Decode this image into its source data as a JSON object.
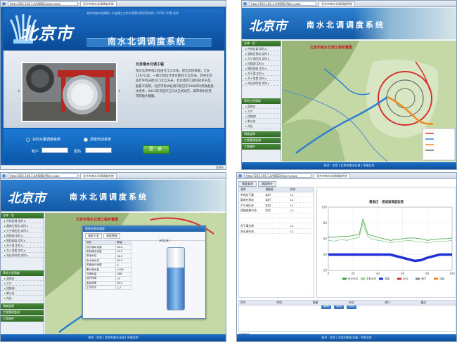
{
  "browser1": {
    "url": "http://202.106.1.0/NSBD/Login.aspx",
    "tab": "北京市南水北调调度系统",
    "zoom": "100%"
  },
  "browser2": {
    "url": "http://202.106.1.0/NSBD/Main.aspx",
    "tab": "北京市南水北调调度系统"
  },
  "browser3": {
    "url": "http://202.106.1.0/NSBD/Main.aspx",
    "tab": "北京市南水北调调度系统"
  },
  "browser4": {
    "url": "http://202.106.1.0/NSBD/Query.aspx",
    "tab": "北京市南水北调调度系统"
  },
  "login": {
    "logo": "北京市",
    "toplinks": "北京市南水北调网 | 大连理工大学水资源与防洪研究所 | 2013 | 中国·北京",
    "system_title": "南水北调调度系统",
    "news_title": "北京南水北调工程",
    "news_body": "南水北调中线工程由丹江口水库，经北京团城湖，全长1267公里，一期工程设计调水量95亿立方米，其中北京多年平均分配10.5亿立方米。北京境内工程包括总干渠、配套工程等。北京市南水北调工程已于2008年9月具备通水条件，2014年汛后丹江口水正式进京，城市供水形势得到极大缓解。",
    "radio1": "实时水量调度系统",
    "radio2": "调度培训系统",
    "user_label": "账户",
    "password_label": "密码",
    "login_button": "登 录"
  },
  "app": {
    "logo": "北京市",
    "title": "南水北调调度系统",
    "sidebar_head": "总体 · 总",
    "side_items": [
      "中线总调 实时 ▸",
      "惠南庄泵站 实时 ▸",
      "大宁调压池 实时 ▸",
      "团城湖 实时 ▸",
      "颐和园段 实时 ▸",
      "东干渠 实时 ▸",
      "东十里堡 实时 ▸",
      "亦庄调节池 实时 ▸"
    ],
    "sidebar_head2": "泵站工程调度",
    "side_items2": [
      "惠南庄",
      "大宁",
      "团城湖",
      "郭公庄",
      "亦庄"
    ],
    "sidebar_head3": "调度监测",
    "sidebar_head4": "工程管理监测",
    "sidebar_head5": "工程维护",
    "map_title": "北京市南水北调工程布置图",
    "footer": "技术 · 北京 | 北京市南水北调 | 中国北京"
  },
  "dialog": {
    "title": "惠南庄泵站调度",
    "tabs": [
      "调度方案",
      "调度数据"
    ],
    "headers": [
      "项目",
      "数值"
    ],
    "rows": [
      [
        "设计调水流量",
        "60.0"
      ],
      [
        "实际调水流量",
        "54.2"
      ],
      [
        "前池水位",
        "58.3"
      ],
      [
        "出水池水位",
        "61.0"
      ],
      [
        "机组运行台数",
        "5"
      ],
      [
        "累计调水量",
        "1056"
      ],
      [
        "日调水量",
        "468"
      ],
      [
        "运行时间",
        "24"
      ],
      [
        "泵站效率",
        "83.5"
      ],
      [
        "工作水头",
        "2.7"
      ]
    ],
    "gauge_title": "水位(米)",
    "gauge_level": 0.68
  },
  "query": {
    "tabs": [
      "调度查询",
      "调度统计"
    ],
    "grid_headers": [
      "名称",
      "调度值",
      "时间"
    ],
    "grid_rows": [
      [
        "中线总干渠",
        "实时",
        "12"
      ],
      [
        "惠南庄泵站",
        "实时",
        "12"
      ],
      [
        "大宁调压池",
        "实时",
        "12"
      ],
      [
        "团城湖调节池",
        "实时",
        "12"
      ],
      [
        "",
        "",
        ""
      ],
      [
        "",
        "",
        ""
      ],
      [
        "东干渠全线",
        "",
        "12"
      ],
      [
        "亦庄调节池",
        "",
        "12"
      ]
    ],
    "chart_title": "惠南庄 · 团城湖调度监测",
    "buttons": [
      "查询",
      "导出",
      "打印"
    ],
    "bottom_headers": [
      "序号",
      "时间",
      "流量",
      "水位",
      "闸门",
      "备注"
    ],
    "bottom_tab": "调度数据"
  },
  "chart_data": {
    "type": "line",
    "title": "惠南庄 · 团城湖调度监测",
    "x": [
      0,
      5,
      10,
      15,
      20,
      25,
      28,
      30,
      32,
      35,
      40,
      45,
      50,
      55,
      60,
      65,
      70,
      75,
      80,
      85,
      90,
      95,
      100
    ],
    "series": [
      {
        "name": "设计水位",
        "values": [
          62,
          62,
          63,
          63,
          64,
          66,
          85,
          75,
          66,
          64,
          62,
          60,
          58,
          59,
          60,
          61,
          61,
          60,
          58,
          59,
          60,
          60,
          61
        ]
      },
      {
        "name": "实际水位",
        "values": [
          58,
          57,
          59,
          58,
          60,
          62,
          80,
          70,
          63,
          60,
          58,
          57,
          55,
          56,
          57,
          58,
          57,
          56,
          55,
          56,
          57,
          57,
          58
        ]
      },
      {
        "name": "流量",
        "values": [
          40,
          40,
          40,
          40,
          40,
          40,
          40,
          40,
          40,
          40,
          40,
          40,
          40,
          38,
          36,
          34,
          32,
          33,
          36,
          38,
          40,
          40,
          40
        ]
      }
    ],
    "legend": [
      "设计水位",
      "实际水位",
      "流量",
      "水位",
      "闸门",
      "流量"
    ],
    "ylim": [
      20,
      100
    ],
    "grid": true,
    "legend_position": "bottom"
  }
}
